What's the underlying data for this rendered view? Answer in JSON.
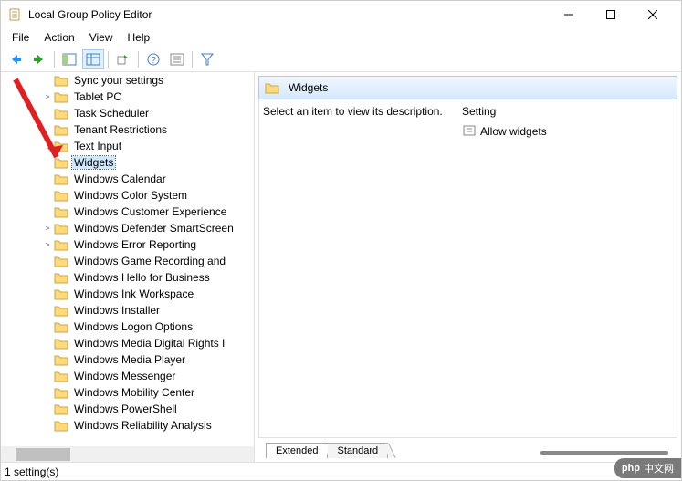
{
  "window": {
    "title": "Local Group Policy Editor"
  },
  "menu": [
    "File",
    "Action",
    "View",
    "Help"
  ],
  "tree": {
    "items": [
      {
        "label": "Sync your settings",
        "selected": false
      },
      {
        "label": "Tablet PC",
        "selected": false,
        "expander": ">"
      },
      {
        "label": "Task Scheduler",
        "selected": false
      },
      {
        "label": "Tenant Restrictions",
        "selected": false
      },
      {
        "label": "Text Input",
        "selected": false
      },
      {
        "label": "Widgets",
        "selected": true
      },
      {
        "label": "Windows Calendar",
        "selected": false
      },
      {
        "label": "Windows Color System",
        "selected": false
      },
      {
        "label": "Windows Customer Experience",
        "selected": false
      },
      {
        "label": "Windows Defender SmartScreen",
        "selected": false,
        "expander": ">"
      },
      {
        "label": "Windows Error Reporting",
        "selected": false,
        "expander": ">"
      },
      {
        "label": "Windows Game Recording and",
        "selected": false
      },
      {
        "label": "Windows Hello for Business",
        "selected": false
      },
      {
        "label": "Windows Ink Workspace",
        "selected": false
      },
      {
        "label": "Windows Installer",
        "selected": false
      },
      {
        "label": "Windows Logon Options",
        "selected": false
      },
      {
        "label": "Windows Media Digital Rights I",
        "selected": false
      },
      {
        "label": "Windows Media Player",
        "selected": false
      },
      {
        "label": "Windows Messenger",
        "selected": false
      },
      {
        "label": "Windows Mobility Center",
        "selected": false
      },
      {
        "label": "Windows PowerShell",
        "selected": false
      },
      {
        "label": "Windows Reliability Analysis",
        "selected": false
      }
    ]
  },
  "right": {
    "header": "Widgets",
    "description": "Select an item to view its description.",
    "column_header": "Setting",
    "rows": [
      {
        "label": "Allow widgets"
      }
    ],
    "tabs": [
      "Extended",
      "Standard"
    ],
    "active_tab": 0
  },
  "status": "1 setting(s)",
  "watermark": "中文网"
}
